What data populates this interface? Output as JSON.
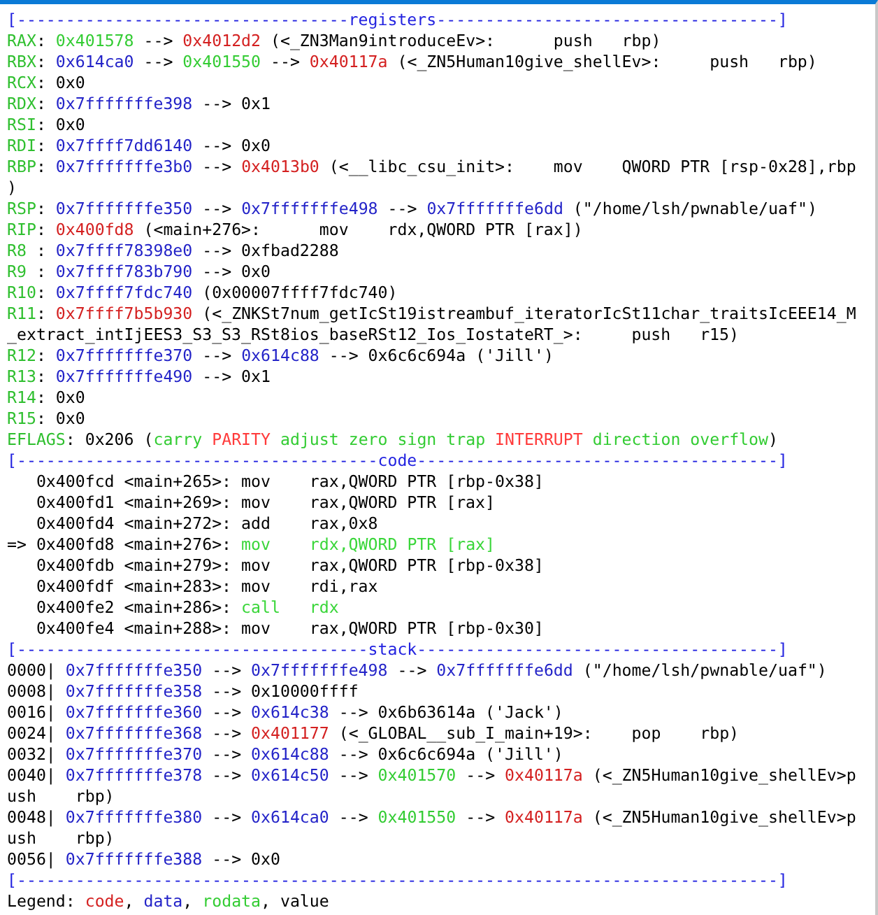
{
  "lines": [
    {
      "segments": [
        {
          "text": "[----------------------------------registers-----------------------------------]",
          "color": "#2323e0"
        }
      ]
    },
    {
      "segments": [
        {
          "text": "RAX",
          "color": "#2fbf2f"
        },
        {
          "text": ": "
        },
        {
          "text": "0x401578",
          "color": "#33cc33"
        },
        {
          "text": " --> "
        },
        {
          "text": "0x4012d2",
          "color": "#d42020"
        },
        {
          "text": " (<_ZN3Man9introduceEv>:      push   rbp)"
        }
      ]
    },
    {
      "segments": [
        {
          "text": "RBX",
          "color": "#2fbf2f"
        },
        {
          "text": ": "
        },
        {
          "text": "0x614ca0",
          "color": "#2323c8"
        },
        {
          "text": " --> "
        },
        {
          "text": "0x401550",
          "color": "#33cc33"
        },
        {
          "text": " --> "
        },
        {
          "text": "0x40117a",
          "color": "#d42020"
        },
        {
          "text": " (<_ZN5Human10give_shellEv>:     push   rbp)"
        }
      ]
    },
    {
      "segments": [
        {
          "text": "RCX",
          "color": "#2fbf2f"
        },
        {
          "text": ": 0x0"
        }
      ]
    },
    {
      "segments": [
        {
          "text": "RDX",
          "color": "#2fbf2f"
        },
        {
          "text": ": "
        },
        {
          "text": "0x7fffffffe398",
          "color": "#2323c8"
        },
        {
          "text": " --> 0x1"
        }
      ]
    },
    {
      "segments": [
        {
          "text": "RSI",
          "color": "#2fbf2f"
        },
        {
          "text": ": 0x0"
        }
      ]
    },
    {
      "segments": [
        {
          "text": "RDI",
          "color": "#2fbf2f"
        },
        {
          "text": ": "
        },
        {
          "text": "0x7ffff7dd6140",
          "color": "#2323c8"
        },
        {
          "text": " --> 0x0"
        }
      ]
    },
    {
      "segments": [
        {
          "text": "RBP",
          "color": "#2fbf2f"
        },
        {
          "text": ": "
        },
        {
          "text": "0x7fffffffe3b0",
          "color": "#2323c8"
        },
        {
          "text": " --> "
        },
        {
          "text": "0x4013b0",
          "color": "#d42020"
        },
        {
          "text": " (<__libc_csu_init>:    mov    QWORD PTR [rsp-0x28],rbp"
        }
      ]
    },
    {
      "segments": [
        {
          "text": ")"
        }
      ]
    },
    {
      "segments": [
        {
          "text": "RSP",
          "color": "#2fbf2f"
        },
        {
          "text": ": "
        },
        {
          "text": "0x7fffffffe350",
          "color": "#2323c8"
        },
        {
          "text": " --> "
        },
        {
          "text": "0x7fffffffe498",
          "color": "#2323c8"
        },
        {
          "text": " --> "
        },
        {
          "text": "0x7fffffffe6dd",
          "color": "#2323c8"
        },
        {
          "text": " (\"/home/lsh/pwnable/uaf\")"
        }
      ]
    },
    {
      "segments": [
        {
          "text": "RIP",
          "color": "#2fbf2f"
        },
        {
          "text": ": "
        },
        {
          "text": "0x400fd8",
          "color": "#d42020"
        },
        {
          "text": " (<main+276>:      mov    rdx,QWORD PTR [rax])"
        }
      ]
    },
    {
      "segments": [
        {
          "text": "R8 ",
          "color": "#2fbf2f"
        },
        {
          "text": ": "
        },
        {
          "text": "0x7ffff78398e0",
          "color": "#2323c8"
        },
        {
          "text": " --> 0xfbad2288"
        }
      ]
    },
    {
      "segments": [
        {
          "text": "R9 ",
          "color": "#2fbf2f"
        },
        {
          "text": ": "
        },
        {
          "text": "0x7ffff783b790",
          "color": "#2323c8"
        },
        {
          "text": " --> 0x0"
        }
      ]
    },
    {
      "segments": [
        {
          "text": "R10",
          "color": "#2fbf2f"
        },
        {
          "text": ": "
        },
        {
          "text": "0x7ffff7fdc740",
          "color": "#2323c8"
        },
        {
          "text": " (0x00007ffff7fdc740)"
        }
      ]
    },
    {
      "segments": [
        {
          "text": "R11",
          "color": "#2fbf2f"
        },
        {
          "text": ": "
        },
        {
          "text": "0x7ffff7b5b930",
          "color": "#d42020"
        },
        {
          "text": " (<_ZNKSt7num_getIcSt19istreambuf_iteratorIcSt11char_traitsIcEEE14_M"
        }
      ]
    },
    {
      "segments": [
        {
          "text": "_extract_intIjEES3_S3_S3_RSt8ios_baseRSt12_Ios_IostateRT_>:     push   r15)"
        }
      ]
    },
    {
      "segments": [
        {
          "text": "R12",
          "color": "#2fbf2f"
        },
        {
          "text": ": "
        },
        {
          "text": "0x7fffffffe370",
          "color": "#2323c8"
        },
        {
          "text": " --> "
        },
        {
          "text": "0x614c88",
          "color": "#2323c8"
        },
        {
          "text": " --> 0x6c6c694a ('Jill')"
        }
      ]
    },
    {
      "segments": [
        {
          "text": "R13",
          "color": "#2fbf2f"
        },
        {
          "text": ": "
        },
        {
          "text": "0x7fffffffe490",
          "color": "#2323c8"
        },
        {
          "text": " --> 0x1"
        }
      ]
    },
    {
      "segments": [
        {
          "text": "R14",
          "color": "#2fbf2f"
        },
        {
          "text": ": 0x0"
        }
      ]
    },
    {
      "segments": [
        {
          "text": "R15",
          "color": "#2fbf2f"
        },
        {
          "text": ": 0x0"
        }
      ]
    },
    {
      "segments": [
        {
          "text": "EFLAGS",
          "color": "#2fbf2f"
        },
        {
          "text": ": 0x206 ("
        },
        {
          "text": "carry ",
          "color": "#33cc33"
        },
        {
          "text": "PARITY",
          "color": "#ff3b3b"
        },
        {
          "text": " adjust zero sign trap ",
          "color": "#33cc33"
        },
        {
          "text": "INTERRUPT",
          "color": "#ff3b3b"
        },
        {
          "text": " direction overflow",
          "color": "#33cc33"
        },
        {
          "text": ")"
        }
      ]
    },
    {
      "segments": [
        {
          "text": "[-------------------------------------code-------------------------------------]",
          "color": "#2323e0"
        }
      ]
    },
    {
      "segments": [
        {
          "text": "   0x400fcd <main+265>: mov    rax,QWORD PTR [rbp-0x38]"
        }
      ]
    },
    {
      "segments": [
        {
          "text": "   0x400fd1 <main+269>: mov    rax,QWORD PTR [rax]"
        }
      ]
    },
    {
      "segments": [
        {
          "text": "   0x400fd4 <main+272>: add    rax,0x8"
        }
      ]
    },
    {
      "segments": [
        {
          "text": "=> 0x400fd8 <main+276>: "
        },
        {
          "text": "mov    rdx,QWORD PTR [rax]",
          "color": "#3ad63a"
        }
      ]
    },
    {
      "segments": [
        {
          "text": "   0x400fdb <main+279>: mov    rax,QWORD PTR [rbp-0x38]"
        }
      ]
    },
    {
      "segments": [
        {
          "text": "   0x400fdf <main+283>: mov    rdi,rax"
        }
      ]
    },
    {
      "segments": [
        {
          "text": "   0x400fe2 <main+286>: "
        },
        {
          "text": "call   rdx",
          "color": "#3ad63a"
        }
      ]
    },
    {
      "segments": [
        {
          "text": "   0x400fe4 <main+288>: mov    rax,QWORD PTR [rbp-0x30]"
        }
      ]
    },
    {
      "segments": [
        {
          "text": "[------------------------------------stack-------------------------------------]",
          "color": "#2323e0"
        }
      ]
    },
    {
      "segments": [
        {
          "text": "0000| "
        },
        {
          "text": "0x7fffffffe350",
          "color": "#2323c8"
        },
        {
          "text": " --> "
        },
        {
          "text": "0x7fffffffe498",
          "color": "#2323c8"
        },
        {
          "text": " --> "
        },
        {
          "text": "0x7fffffffe6dd",
          "color": "#2323c8"
        },
        {
          "text": " (\"/home/lsh/pwnable/uaf\")"
        }
      ]
    },
    {
      "segments": [
        {
          "text": "0008| "
        },
        {
          "text": "0x7fffffffe358",
          "color": "#2323c8"
        },
        {
          "text": " --> 0x10000ffff"
        }
      ]
    },
    {
      "segments": [
        {
          "text": "0016| "
        },
        {
          "text": "0x7fffffffe360",
          "color": "#2323c8"
        },
        {
          "text": " --> "
        },
        {
          "text": "0x614c38",
          "color": "#2323c8"
        },
        {
          "text": " --> 0x6b63614a ('Jack')"
        }
      ]
    },
    {
      "segments": [
        {
          "text": "0024| "
        },
        {
          "text": "0x7fffffffe368",
          "color": "#2323c8"
        },
        {
          "text": " --> "
        },
        {
          "text": "0x401177",
          "color": "#d42020"
        },
        {
          "text": " (<_GLOBAL__sub_I_main+19>:    pop    rbp)"
        }
      ]
    },
    {
      "segments": [
        {
          "text": "0032| "
        },
        {
          "text": "0x7fffffffe370",
          "color": "#2323c8"
        },
        {
          "text": " --> "
        },
        {
          "text": "0x614c88",
          "color": "#2323c8"
        },
        {
          "text": " --> 0x6c6c694a ('Jill')"
        }
      ]
    },
    {
      "segments": [
        {
          "text": "0040| "
        },
        {
          "text": "0x7fffffffe378",
          "color": "#2323c8"
        },
        {
          "text": " --> "
        },
        {
          "text": "0x614c50",
          "color": "#2323c8"
        },
        {
          "text": " --> "
        },
        {
          "text": "0x401570",
          "color": "#33cc33"
        },
        {
          "text": " --> "
        },
        {
          "text": "0x40117a",
          "color": "#d42020"
        },
        {
          "text": " (<_ZN5Human10give_shellEv>p"
        }
      ]
    },
    {
      "segments": [
        {
          "text": "ush    rbp)"
        }
      ]
    },
    {
      "segments": [
        {
          "text": "0048| "
        },
        {
          "text": "0x7fffffffe380",
          "color": "#2323c8"
        },
        {
          "text": " --> "
        },
        {
          "text": "0x614ca0",
          "color": "#2323c8"
        },
        {
          "text": " --> "
        },
        {
          "text": "0x401550",
          "color": "#33cc33"
        },
        {
          "text": " --> "
        },
        {
          "text": "0x40117a",
          "color": "#d42020"
        },
        {
          "text": " (<_ZN5Human10give_shellEv>p"
        }
      ]
    },
    {
      "segments": [
        {
          "text": "ush    rbp)"
        }
      ]
    },
    {
      "segments": [
        {
          "text": "0056| "
        },
        {
          "text": "0x7fffffffe388",
          "color": "#2323c8"
        },
        {
          "text": " --> 0x0"
        }
      ]
    },
    {
      "segments": [
        {
          "text": "[------------------------------------------------------------------------------]",
          "color": "#2323e0"
        }
      ]
    },
    {
      "segments": [
        {
          "text": "Legend: "
        },
        {
          "text": "code",
          "color": "#d42020"
        },
        {
          "text": ", "
        },
        {
          "text": "data",
          "color": "#2323c8"
        },
        {
          "text": ", "
        },
        {
          "text": "rodata",
          "color": "#33cc33"
        },
        {
          "text": ", value"
        }
      ]
    }
  ]
}
